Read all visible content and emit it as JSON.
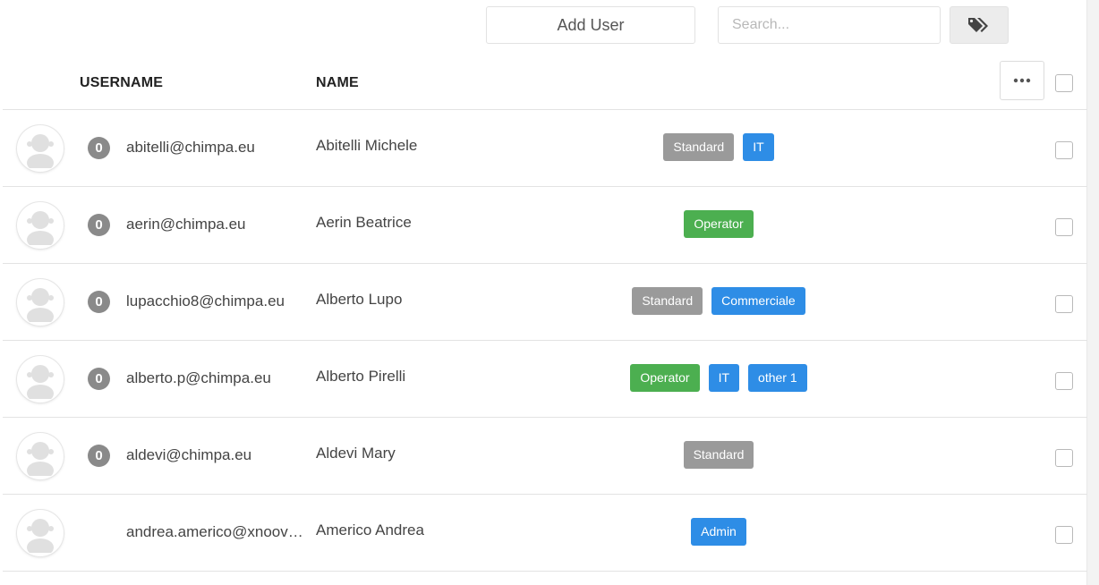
{
  "toolbar": {
    "add_user_label": "Add User",
    "search_placeholder": "Search...",
    "tags_icon": "tags-icon"
  },
  "table": {
    "columns": [
      "USERNAME",
      "NAME"
    ],
    "more_icon": "more-dots-icon",
    "rows": [
      {
        "count": "0",
        "username": "abitelli@chimpa.eu",
        "name": "Abitelli Michele",
        "tags": [
          {
            "label": "Standard",
            "color": "#9a9a9a"
          },
          {
            "label": "IT",
            "color": "#2e8de6"
          }
        ]
      },
      {
        "count": "0",
        "username": "aerin@chimpa.eu",
        "name": "Aerin Beatrice",
        "tags": [
          {
            "label": "Operator",
            "color": "#4caf50"
          }
        ]
      },
      {
        "count": "0",
        "username": "lupacchio8@chimpa.eu",
        "name": "Alberto Lupo",
        "tags": [
          {
            "label": "Standard",
            "color": "#9a9a9a"
          },
          {
            "label": "Commerciale",
            "color": "#2e8de6"
          }
        ]
      },
      {
        "count": "0",
        "username": "alberto.p@chimpa.eu",
        "name": "Alberto Pirelli",
        "tags": [
          {
            "label": "Operator",
            "color": "#4caf50"
          },
          {
            "label": "IT",
            "color": "#2e8de6"
          },
          {
            "label": "other 1",
            "color": "#2e8de6"
          }
        ]
      },
      {
        "count": "0",
        "username": "aldevi@chimpa.eu",
        "name": "Aldevi Mary",
        "tags": [
          {
            "label": "Standard",
            "color": "#9a9a9a"
          }
        ]
      },
      {
        "count": "",
        "username": "andrea.americo@xnoov…",
        "name": "Americo Andrea",
        "tags": [
          {
            "label": "Admin",
            "color": "#2e8de6"
          }
        ]
      }
    ]
  }
}
